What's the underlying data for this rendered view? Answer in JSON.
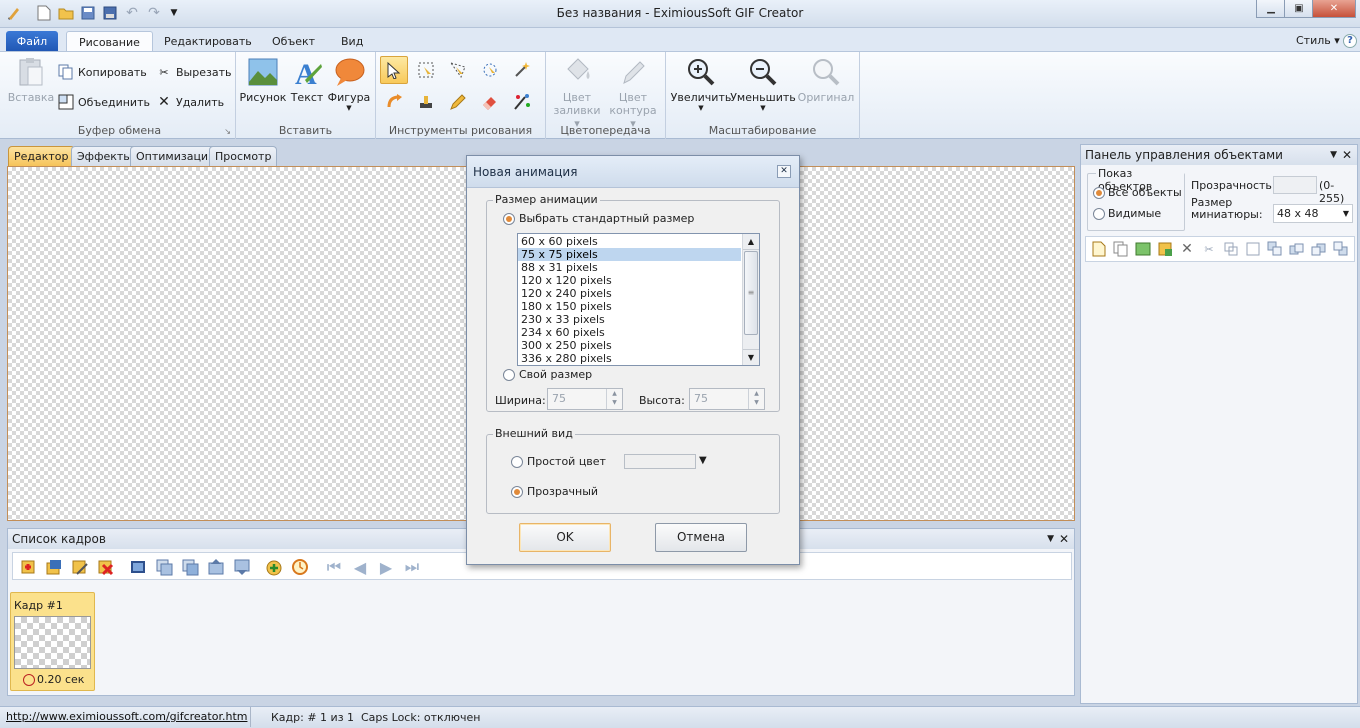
{
  "window": {
    "title": "Без названия - EximiousSoft GIF Creator",
    "style_label": "Стиль"
  },
  "ribbon_tabs": [
    "Файл",
    "Рисование",
    "Редактировать",
    "Объект",
    "Вид"
  ],
  "clipboard": {
    "paste": "Вставка",
    "copy": "Копировать",
    "merge": "Объединить",
    "cut": "Вырезать",
    "delete": "Удалить",
    "group": "Буфер обмена"
  },
  "insert": {
    "picture": "Рисунок",
    "text": "Текст",
    "shape": "Фигура",
    "group": "Вставить"
  },
  "draw_tools": {
    "group": "Инструменты рисования"
  },
  "color": {
    "fill_1": "Цвет",
    "fill_2": "заливки",
    "outline_1": "Цвет",
    "outline_2": "контура",
    "group": "Цветопередача"
  },
  "zoom": {
    "zoom_in": "Увеличить",
    "zoom_out": "Уменьшить",
    "original": "Оригинал",
    "group": "Масштабирование"
  },
  "doc_tabs": [
    "Редактор",
    "Эффекты",
    "Оптимизация",
    "Просмотр"
  ],
  "frames_panel": {
    "title": "Список кадров",
    "frame_name": "Кадр #1",
    "frame_time": "0.20 сек"
  },
  "objects_panel": {
    "title": "Панель управления объектами",
    "show_label": "Показ объектов",
    "all_objects": "Все объекты",
    "visible": "Видимые",
    "transparency_label": "Прозрачность:",
    "transparency_range": "(0-255)",
    "thumb_label_1": "Размер",
    "thumb_label_2": "миниатюры:",
    "thumb_value": "48 x 48"
  },
  "status": {
    "link": "http://www.eximioussoft.com/gifcreator.htm",
    "frame": "Кадр: # 1 из 1",
    "caps": "Caps Lock: отключен"
  },
  "dialog": {
    "title": "Новая анимация",
    "size_group": "Размер анимации",
    "standard_size": "Выбрать стандартный размер",
    "sizes": [
      "60 x 60 pixels",
      "75 x 75 pixels",
      "88 x 31 pixels",
      "120 x 120 pixels",
      "120 x 240 pixels",
      "180 x 150 pixels",
      "230 x 33 pixels",
      "234 x 60 pixels",
      "300 x 250 pixels",
      "336 x 280 pixels"
    ],
    "selected_size": "75 x 75 pixels",
    "custom_size": "Свой размер",
    "width_label": "Ширина:",
    "width_value": "75",
    "height_label": "Высота:",
    "height_value": "75",
    "appearance_group": "Внешний вид",
    "plain_color": "Простой цвет",
    "transparent": "Прозрачный",
    "ok": "OK",
    "cancel": "Отмена"
  }
}
